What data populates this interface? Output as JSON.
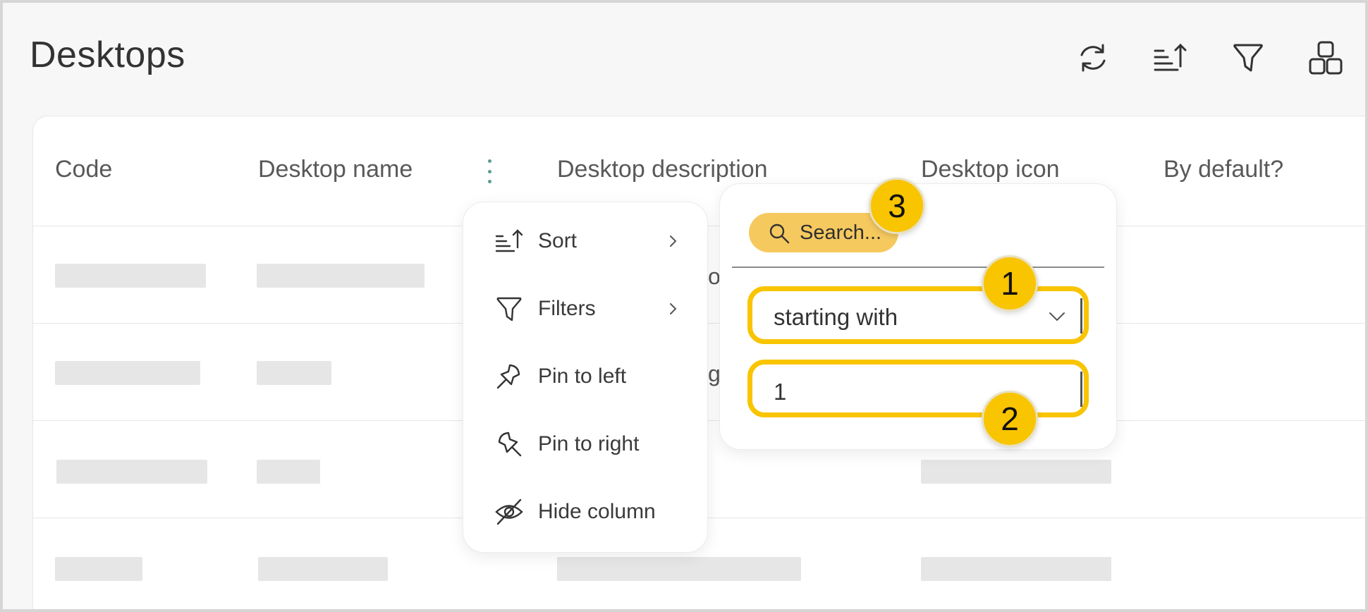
{
  "header": {
    "title": "Desktops",
    "icons": [
      "refresh-icon",
      "sort-icon",
      "filter-icon",
      "grid-layout-icon"
    ]
  },
  "columns": {
    "code": "Code",
    "name": "Desktop name",
    "description": "Desktop description",
    "icon": "Desktop icon",
    "default": "By default?"
  },
  "partials": {
    "row1_desc": "o",
    "row2_desc": "g"
  },
  "column_menu": {
    "items": [
      {
        "label": "Sort",
        "icon": "sort-icon",
        "has_submenu": true
      },
      {
        "label": "Filters",
        "icon": "filter-icon",
        "has_submenu": true
      },
      {
        "label": "Pin to left",
        "icon": "pin-left-icon",
        "has_submenu": false
      },
      {
        "label": "Pin to right",
        "icon": "pin-right-icon",
        "has_submenu": false
      },
      {
        "label": "Hide column",
        "icon": "eye-off-icon",
        "has_submenu": false
      }
    ]
  },
  "filter_panel": {
    "search_placeholder": "Search...",
    "operator": "starting with",
    "value": "1"
  },
  "callouts": [
    "1",
    "2",
    "3"
  ],
  "colors": {
    "accent": "#f9c400",
    "search_pill": "#f6c95f",
    "kebab": "#5a9c93",
    "skeleton": "#e6e6e6"
  }
}
